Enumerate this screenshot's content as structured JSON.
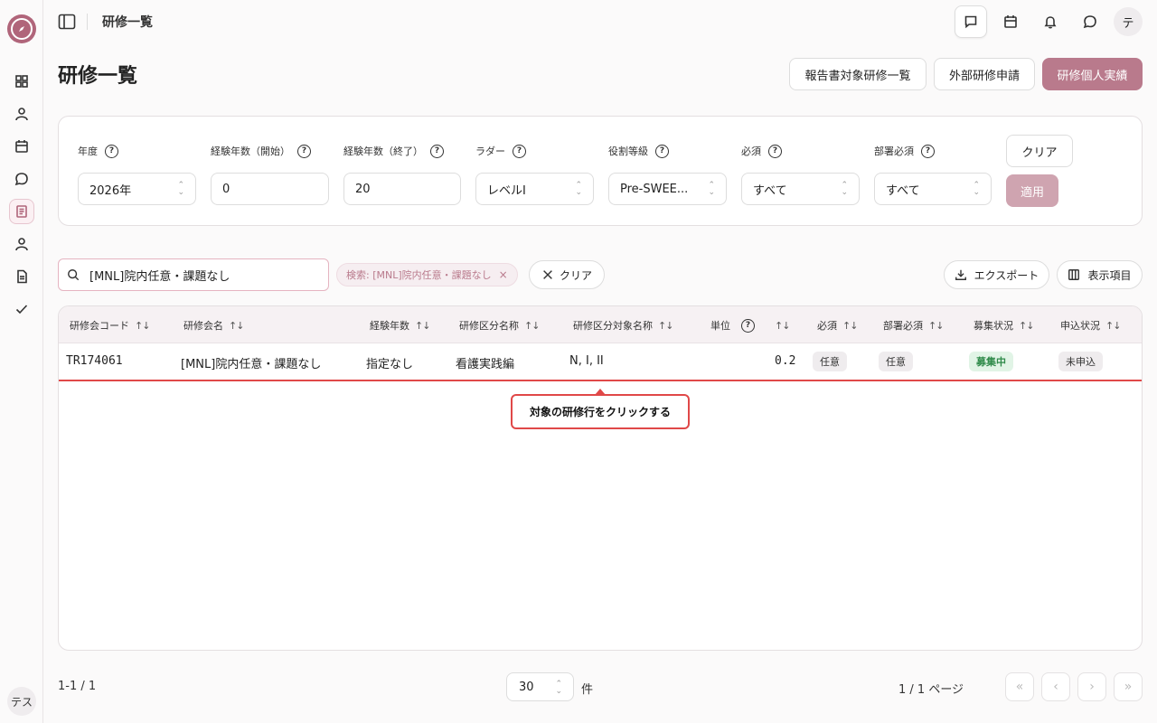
{
  "topbar": {
    "breadcrumb": "研修一覧"
  },
  "user": {
    "avatar_initial": "テ",
    "sidebar_initials": "テス"
  },
  "page": {
    "title": "研修一覧"
  },
  "actions": {
    "report_list": "報告書対象研修一覧",
    "external_apply": "外部研修申請",
    "personal_record": "研修個人実績"
  },
  "filters": {
    "year": {
      "label": "年度",
      "value": "2026年"
    },
    "exp_start": {
      "label": "経験年数（開始）",
      "value": "0"
    },
    "exp_end": {
      "label": "経験年数（終了）",
      "value": "20"
    },
    "ladder": {
      "label": "ラダー",
      "value": "レベルI"
    },
    "role_grade": {
      "label": "役割等級",
      "value": "Pre-SWEE..."
    },
    "required": {
      "label": "必須",
      "value": "すべて"
    },
    "dept_required": {
      "label": "部署必須",
      "value": "すべて"
    },
    "clear_label": "クリア",
    "apply_label": "適用"
  },
  "search": {
    "value": "[MNL]院内任意・課題なし",
    "chip": "検索: [MNL]院内任意・課題なし",
    "clear_label": "クリア"
  },
  "toolbar": {
    "export_label": "エクスポート",
    "columns_label": "表示項目"
  },
  "table": {
    "headers": {
      "code": "研修会コード",
      "name": "研修会名",
      "experience": "経験年数",
      "category": "研修区分名称",
      "target": "研修区分対象名称",
      "units": "単位",
      "required": "必須",
      "dept_required": "部署必須",
      "recruit_status": "募集状況",
      "apply_status": "申込状況"
    },
    "rows": [
      {
        "code": "TR174061",
        "name": "[MNL]院内任意・課題なし",
        "experience": "指定なし",
        "category": "看護実践編",
        "target": "N, I, II",
        "units": "0.2",
        "required": "任意",
        "dept_required": "任意",
        "recruit_status": "募集中",
        "apply_status": "未申込"
      }
    ]
  },
  "tooltip": {
    "text": "対象の研修行をクリックする"
  },
  "footer": {
    "count": "1-1 / 1",
    "per_page": "30",
    "unit": "件",
    "page_info": "1 / 1 ページ"
  },
  "colors": {
    "accent": "#b97a8c",
    "highlight": "#e04848",
    "success": "#2f8a4a"
  }
}
